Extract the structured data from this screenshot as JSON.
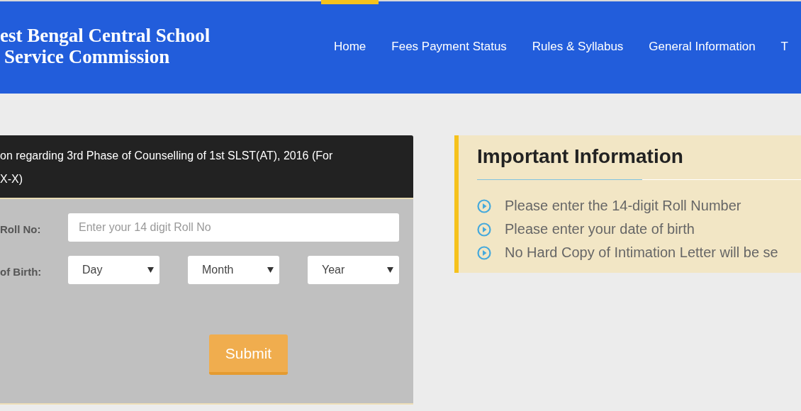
{
  "header": {
    "logo_lines": [
      "est Bengal Central School",
      "Service Commission"
    ],
    "nav": [
      {
        "label": "Home",
        "selected": true
      },
      {
        "label": "Fees Payment Status",
        "selected": false
      },
      {
        "label": "Rules & Syllabus",
        "selected": false
      },
      {
        "label": "General Information",
        "selected": false
      },
      {
        "label": "T",
        "selected": false
      }
    ]
  },
  "form_card": {
    "title_lines": [
      "on regarding 3rd Phase of Counselling of 1st SLST(AT), 2016 (For",
      "X-X)"
    ],
    "roll_label": "Roll No:",
    "roll_field": {
      "placeholder": "Enter your 14 digit Roll No"
    },
    "dob_label": "of Birth:",
    "dob_selects": [
      "Day",
      "Month",
      "Year"
    ],
    "submit": "Submit"
  },
  "info_box": {
    "title": "Important Information",
    "items": [
      "Please enter the 14-digit Roll Number",
      "Please enter your date of birth",
      "No Hard Copy of Intimation Letter will be se"
    ]
  }
}
